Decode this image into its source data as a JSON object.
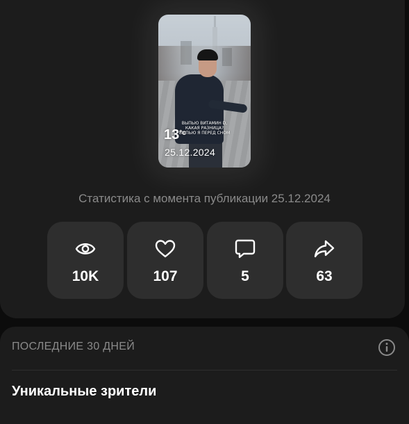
{
  "video": {
    "caption_lines": [
      "ВЫПЬЮ ВИТАМИН D,",
      "КАКАЯ РАЗНИЦА?",
      "ВЫПЬЮ Я ПЕРЕД СНОМ"
    ],
    "temperature": "13",
    "temperature_unit": "°c",
    "date": "25.12.2024"
  },
  "stats": {
    "caption": "Статистика с момента публикации 25.12.2024",
    "items": [
      {
        "icon": "eye-icon",
        "value": "10K"
      },
      {
        "icon": "heart-icon",
        "value": "107"
      },
      {
        "icon": "comment-icon",
        "value": "5"
      },
      {
        "icon": "share-icon",
        "value": "63"
      }
    ]
  },
  "period_section": {
    "title": "ПОСЛЕДНИЕ 30 ДНЕЙ",
    "info_icon": "info-icon",
    "heading": "Уникальные зрители"
  },
  "colors": {
    "background": "#0c0c0c",
    "card": "#1c1c1c",
    "stat_card": "#2e2e2e",
    "muted_text": "#8a8a8a"
  }
}
